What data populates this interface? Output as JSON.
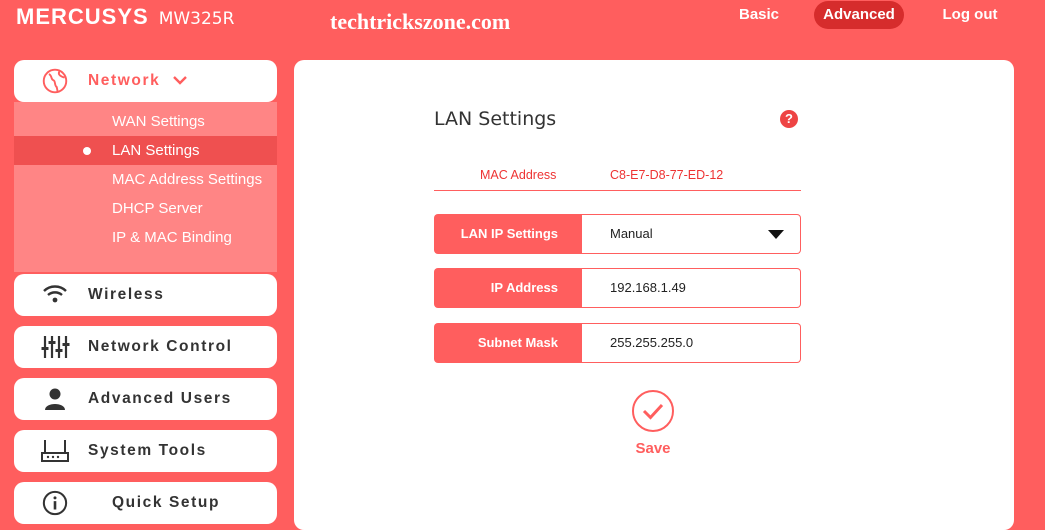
{
  "header": {
    "brand": "MERCUSYS",
    "model": "MW325R",
    "watermark": "techtrickszone.com",
    "nav": {
      "basic": "Basic",
      "advanced": "Advanced",
      "logout": "Log out"
    }
  },
  "sidebar": {
    "network": {
      "label": "Network",
      "submenu": [
        "WAN Settings",
        "LAN Settings",
        "MAC Address Settings",
        "DHCP Server",
        "IP & MAC Binding"
      ],
      "active_index": 1
    },
    "items": [
      {
        "label": "Wireless",
        "icon": "wifi-icon"
      },
      {
        "label": "Network Control",
        "icon": "sliders-icon"
      },
      {
        "label": "Advanced Users",
        "icon": "user-icon"
      },
      {
        "label": "System Tools",
        "icon": "router-icon"
      },
      {
        "label": "Quick Setup",
        "icon": "info-icon"
      }
    ]
  },
  "main": {
    "title": "LAN Settings",
    "help": "?",
    "mac": {
      "label": "MAC Address",
      "value": "C8-E7-D8-77-ED-12"
    },
    "lan_ip_settings": {
      "label": "LAN IP Settings",
      "value": "Manual"
    },
    "ip_address": {
      "label": "IP Address",
      "value": "192.168.1.49"
    },
    "subnet_mask": {
      "label": "Subnet Mask",
      "value": "255.255.255.0"
    },
    "save_label": "Save"
  },
  "colors": {
    "accent": "#ff5e5e",
    "active_pill": "#d62c2c",
    "submenu_bg": "#ff8585"
  }
}
